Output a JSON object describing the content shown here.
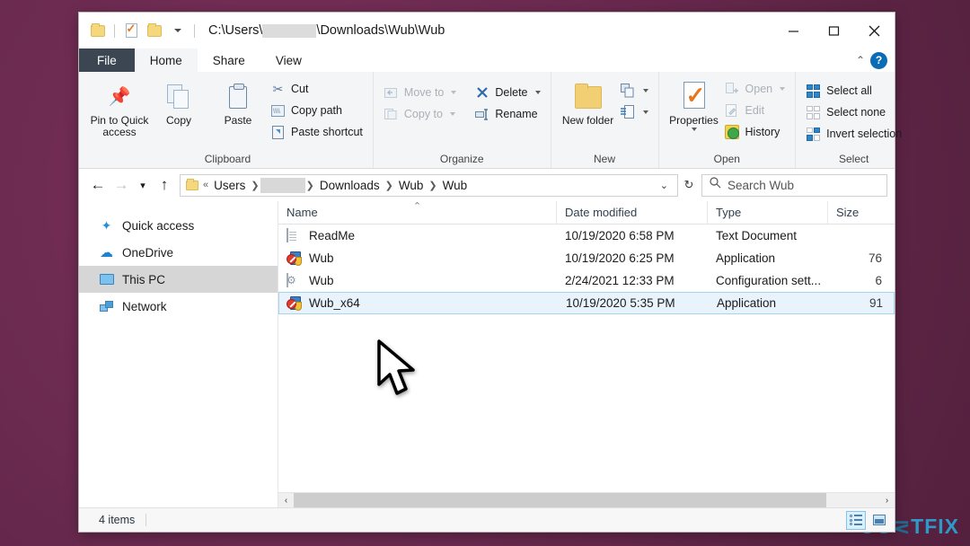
{
  "desktop": {
    "background_color": "#6d2b52",
    "watermark": "UGETFIX",
    "watermark_color": "#2f9fd0"
  },
  "window": {
    "title_path": "C:\\Users\\",
    "title_path_tail": "\\Downloads\\Wub\\Wub",
    "quick_access_icons": [
      "folder-icon",
      "properties-icon",
      "folder-icon",
      "chevron-down-icon"
    ],
    "controls": {
      "minimize": "minimize-button",
      "maximize": "maximize-button",
      "close": "close-button"
    }
  },
  "ribbon": {
    "tabs": [
      {
        "label": "File",
        "id": "tab-file"
      },
      {
        "label": "Home",
        "id": "tab-home"
      },
      {
        "label": "Share",
        "id": "tab-share"
      },
      {
        "label": "View",
        "id": "tab-view"
      }
    ],
    "active_tab": "Home",
    "collapse_caret": "⌃",
    "help_label": "?",
    "groups": [
      {
        "label": "Clipboard",
        "big_buttons": [
          {
            "label": "Pin to Quick access",
            "icon": "pin-icon"
          },
          {
            "label": "Copy",
            "icon": "copy-icon"
          },
          {
            "label": "Paste",
            "icon": "paste-icon"
          }
        ],
        "small_buttons": [
          {
            "label": "Cut",
            "icon": "scissors-icon",
            "disabled": false
          },
          {
            "label": "Copy path",
            "icon": "copy-path-icon",
            "disabled": false
          },
          {
            "label": "Paste shortcut",
            "icon": "paste-shortcut-icon",
            "disabled": false
          }
        ]
      },
      {
        "label": "Organize",
        "small_buttons": [
          {
            "label": "Move to",
            "icon": "move-to-icon",
            "disabled": true,
            "has_caret": true
          },
          {
            "label": "Copy to",
            "icon": "copy-to-icon",
            "disabled": true,
            "has_caret": true
          },
          {
            "label": "Delete",
            "icon": "delete-x-icon",
            "disabled": false,
            "has_caret": true
          },
          {
            "label": "Rename",
            "icon": "rename-icon",
            "disabled": false
          }
        ]
      },
      {
        "label": "New",
        "big_buttons": [
          {
            "label": "New folder",
            "icon": "new-folder-icon"
          }
        ],
        "small_buttons": [
          {
            "label": "",
            "icon": "new-item-icon",
            "has_caret": true
          },
          {
            "label": "",
            "icon": "easy-access-icon",
            "has_caret": true
          }
        ]
      },
      {
        "label": "Open",
        "big_buttons": [
          {
            "label": "Properties",
            "icon": "properties-icon",
            "has_caret": true
          }
        ],
        "small_buttons": [
          {
            "label": "Open",
            "icon": "open-icon",
            "disabled": true,
            "has_caret": true
          },
          {
            "label": "Edit",
            "icon": "edit-icon",
            "disabled": true
          },
          {
            "label": "History",
            "icon": "history-icon",
            "disabled": false
          }
        ]
      },
      {
        "label": "Select",
        "small_buttons": [
          {
            "label": "Select all",
            "icon": "select-all-icon"
          },
          {
            "label": "Select none",
            "icon": "select-none-icon"
          },
          {
            "label": "Invert selection",
            "icon": "invert-selection-icon"
          }
        ]
      }
    ]
  },
  "addressbar": {
    "back": "back-arrow",
    "forward": "forward-arrow",
    "recent": "chevron-down",
    "up": "up-arrow",
    "overflow": "«",
    "crumbs": [
      "Users",
      "[redacted]",
      "Downloads",
      "Wub",
      "Wub"
    ],
    "dropdown_caret": "⌄",
    "refresh": "↻",
    "search_placeholder": "Search Wub"
  },
  "navpane": {
    "items": [
      {
        "label": "Quick access",
        "icon": "star-icon",
        "selected": false
      },
      {
        "label": "OneDrive",
        "icon": "cloud-icon",
        "selected": false
      },
      {
        "label": "This PC",
        "icon": "monitor-icon",
        "selected": true
      },
      {
        "label": "Network",
        "icon": "network-icon",
        "selected": false
      }
    ]
  },
  "filelist": {
    "columns": [
      {
        "label": "Name",
        "sorted": "asc",
        "sort_glyph": "⌃"
      },
      {
        "label": "Date modified",
        "sorted": ""
      },
      {
        "label": "Type",
        "sorted": ""
      },
      {
        "label": "Size",
        "sorted": ""
      }
    ],
    "rows": [
      {
        "name": "ReadMe",
        "date": "10/19/2020 6:58 PM",
        "type": "Text Document",
        "size": "",
        "icon": "text-document-icon",
        "selected": false
      },
      {
        "name": "Wub",
        "date": "10/19/2020 6:25 PM",
        "type": "Application",
        "size": "76",
        "icon": "application-icon",
        "selected": false
      },
      {
        "name": "Wub",
        "date": "2/24/2021 12:33 PM",
        "type": "Configuration sett...",
        "size": "6",
        "icon": "config-file-icon",
        "selected": false
      },
      {
        "name": "Wub_x64",
        "date": "10/19/2020 5:35 PM",
        "type": "Application",
        "size": "91",
        "icon": "application-icon",
        "selected": true
      }
    ],
    "selection_color": "#e8f3fc"
  },
  "scrollbar": {
    "left_arrow": "‹",
    "right_arrow": "›"
  },
  "statusbar": {
    "item_count": "4 items",
    "views": [
      {
        "icon": "details-view-icon",
        "active": true
      },
      {
        "icon": "thumbnail-view-icon",
        "active": false
      }
    ]
  }
}
